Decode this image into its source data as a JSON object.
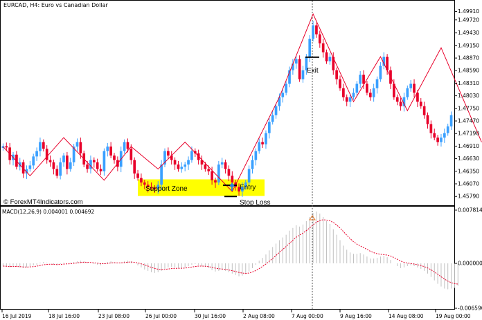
{
  "header": {
    "symbol_title": "EURCAD, H4:  Euro vs Canadian Dollar"
  },
  "watermark": "© ForexMT4Indicators.com",
  "annotations": {
    "support_zone": "Support Zone",
    "entry": "Entry",
    "stop_loss": "Stop Loss",
    "exit": "Exit"
  },
  "macd_panel": {
    "label": "MACD(12,26,9) 0.004001 0.004692",
    "scale_labels": [
      "0.007814",
      "0.000000",
      "-0.006590"
    ]
  },
  "price_axis_labels": [
    "1.49910",
    "1.49720",
    "1.49430",
    "1.49150",
    "1.48870",
    "1.48590",
    "1.48310",
    "1.48030",
    "1.47750",
    "1.47470",
    "1.47190",
    "1.46910",
    "1.46630",
    "1.46350",
    "1.46070",
    "1.45790"
  ],
  "time_axis_labels": [
    "16 Jul 2019",
    "18 Jul 16:00",
    "23 Jul 08:00",
    "26 Jul 00:00",
    "30 Jul 16:00",
    "2 Aug 08:00",
    "7 Aug 00:00",
    "9 Aug 16:00",
    "14 Aug 08:00",
    "19 Aug 00:00"
  ],
  "colors": {
    "bull_candle": "#3aa0ff",
    "bear_candle": "#e8002a",
    "zigzag": "#e8002a",
    "support_zone": "#ffff00",
    "macd_signal": "#e8002a",
    "macd_hist": "#c0c0c0"
  },
  "chart_data": {
    "type": "candlestick",
    "symbol": "EURCAD",
    "timeframe": "H4",
    "price_ylim": [
      1.4567,
      1.5004
    ],
    "close_series": [
      1.4691,
      1.4688,
      1.466,
      1.4672,
      1.4645,
      1.4655,
      1.463,
      1.464,
      1.4648,
      1.4668,
      1.468,
      1.47,
      1.4685,
      1.466,
      1.4655,
      1.464,
      1.4625,
      1.4655,
      1.467,
      1.464,
      1.4655,
      1.469,
      1.47,
      1.4675,
      1.465,
      1.464,
      1.466,
      1.4655,
      1.464,
      1.4635,
      1.468,
      1.469,
      1.467,
      1.466,
      1.4645,
      1.468,
      1.47,
      1.4685,
      1.466,
      1.463,
      1.462,
      1.461,
      1.4605,
      1.46,
      1.4598,
      1.4595,
      1.4605,
      1.465,
      1.468,
      1.467,
      1.466,
      1.465,
      1.464,
      1.4645,
      1.465,
      1.466,
      1.468,
      1.4675,
      1.466,
      1.465,
      1.464,
      1.4635,
      1.4615,
      1.461,
      1.465,
      1.4655,
      1.464,
      1.4625,
      1.461,
      1.46,
      1.459,
      1.46,
      1.461,
      1.464,
      1.466,
      1.468,
      1.47,
      1.4695,
      1.472,
      1.4745,
      1.476,
      1.478,
      1.48,
      1.481,
      1.483,
      1.486,
      1.4875,
      1.4885,
      1.484,
      1.486,
      1.489,
      1.493,
      1.496,
      1.494,
      1.492,
      1.49,
      1.488,
      1.489,
      1.486,
      1.484,
      1.482,
      1.48,
      1.479,
      1.48,
      1.481,
      1.483,
      1.485,
      1.483,
      1.481,
      1.48,
      1.482,
      1.484,
      1.487,
      1.489,
      1.486,
      1.483,
      1.48,
      1.479,
      1.478,
      1.48,
      1.482,
      1.483,
      1.481,
      1.479,
      1.478,
      1.476,
      1.474,
      1.472,
      1.471,
      1.47,
      1.471,
      1.472,
      1.4735,
      1.476
    ],
    "zigzag_price": [
      [
        0,
        1.469
      ],
      [
        8,
        1.4625
      ],
      [
        18,
        1.471
      ],
      [
        30,
        1.4615
      ],
      [
        38,
        1.469
      ],
      [
        46,
        1.464
      ],
      [
        54,
        1.47
      ],
      [
        68,
        1.459
      ],
      [
        82,
        1.48
      ],
      [
        92,
        1.4985
      ],
      [
        104,
        1.479
      ],
      [
        112,
        1.489
      ],
      [
        120,
        1.477
      ],
      [
        130,
        1.491
      ],
      [
        142,
        1.47
      ]
    ],
    "support_zone_price": [
      1.4617,
      1.458
    ],
    "entry_price": 1.4604,
    "stop_loss_price": 1.4579,
    "exit_price": 1.4889,
    "macd": {
      "name": "MACD(12,26,9)",
      "main_value": 0.004001,
      "signal_value": 0.004692,
      "ylim": [
        -0.00659,
        0.007814
      ],
      "histogram": [
        -0.0004,
        -0.0005,
        -0.0006,
        -0.0005,
        -0.0004,
        -0.0006,
        -0.0007,
        -0.0006,
        -0.0004,
        -0.0003,
        -0.0002,
        0.0001,
        0.0002,
        0.0001,
        0.0,
        -0.0002,
        -0.0003,
        -0.0001,
        0.0001,
        0.0,
        0.0001,
        0.0002,
        0.0003,
        0.0004,
        0.0003,
        0.0001,
        0.0,
        -0.0001,
        -0.0002,
        -0.0003,
        -0.0001,
        0.0002,
        0.0003,
        0.0002,
        0.0,
        0.0001,
        0.0003,
        0.0004,
        0.0003,
        0.0,
        -0.0003,
        -0.0006,
        -0.0009,
        -0.0011,
        -0.0013,
        -0.0014,
        -0.0013,
        -0.0011,
        -0.0008,
        -0.0006,
        -0.0005,
        -0.0006,
        -0.0007,
        -0.0007,
        -0.0006,
        -0.0004,
        -0.0002,
        -0.0001,
        -0.0002,
        -0.0004,
        -0.0005,
        -0.0007,
        -0.001,
        -0.0012,
        -0.0011,
        -0.001,
        -0.0011,
        -0.0013,
        -0.0015,
        -0.0017,
        -0.0019,
        -0.0018,
        -0.0016,
        -0.0012,
        -0.0007,
        -0.0002,
        0.0004,
        0.0008,
        0.0013,
        0.0019,
        0.0024,
        0.0029,
        0.0034,
        0.0038,
        0.0042,
        0.0048,
        0.0052,
        0.0056,
        0.0054,
        0.0057,
        0.0062,
        0.0068,
        0.0074,
        0.0076,
        0.0073,
        0.0068,
        0.0062,
        0.0058,
        0.005,
        0.0042,
        0.0034,
        0.0026,
        0.002,
        0.0016,
        0.0014,
        0.0014,
        0.0015,
        0.0013,
        0.001,
        0.0007,
        0.0007,
        0.0008,
        0.001,
        0.0011,
        0.0009,
        0.0005,
        0.0,
        -0.0004,
        -0.0007,
        -0.0006,
        -0.0004,
        -0.0003,
        -0.0004,
        -0.0006,
        -0.0008,
        -0.0011,
        -0.0015,
        -0.002,
        -0.0025,
        -0.003,
        -0.0034,
        -0.0037,
        -0.0038,
        -0.0037,
        -0.0036,
        -0.0033
      ]
    },
    "vertical_marker_at": "7 Aug 08:00"
  }
}
